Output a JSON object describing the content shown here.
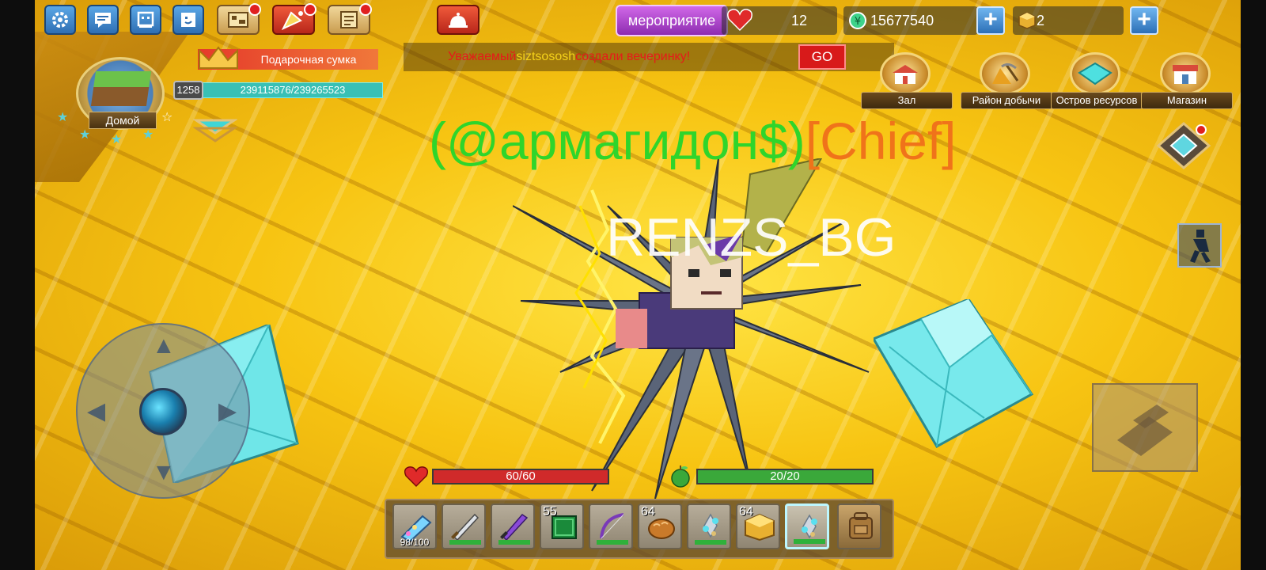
{
  "top_bar": {
    "event_label": "мероприятие",
    "hearts": "12",
    "money": "15677540",
    "gold_blocks": "2"
  },
  "announcement": {
    "prefix": "Уважаемый ",
    "player": "siztsososh",
    "suffix": " создали вечеринку!",
    "go_label": "GO"
  },
  "player_panel": {
    "gift_bag_label": "Подарочная сумка",
    "level": "1258",
    "exp_text": "239115876/239265523",
    "exp_fraction": 0.9994,
    "home_label": "Домой"
  },
  "nav": {
    "hall": "Зал",
    "mining_district": "Район добычи",
    "resource_island": "Остров ресурсов",
    "shop": "Магазин"
  },
  "nametags": {
    "guild_name": "(@армагидон$)",
    "guild_rank": "[Chief]",
    "player_name": "RENZS_BG"
  },
  "stats": {
    "health_text": "60/60",
    "health_fraction": 1.0,
    "hunger_text": "20/20",
    "hunger_fraction": 1.0
  },
  "hotbar": {
    "slots": [
      {
        "item": "drill-gun",
        "count": "",
        "durability": "98/100"
      },
      {
        "item": "sword",
        "count": "",
        "durability": ""
      },
      {
        "item": "purple-sword",
        "count": "",
        "durability": ""
      },
      {
        "item": "emerald-block",
        "count": "55",
        "durability": ""
      },
      {
        "item": "bow",
        "count": "",
        "durability": ""
      },
      {
        "item": "bread",
        "count": "64",
        "durability": ""
      },
      {
        "item": "diamond-ore",
        "count": "",
        "durability": ""
      },
      {
        "item": "gold-block",
        "count": "64",
        "durability": ""
      },
      {
        "item": "diamond-ore",
        "count": "",
        "durability": ""
      },
      {
        "item": "backpack",
        "count": "",
        "durability": ""
      }
    ]
  },
  "colors": {
    "guild_name": "#2fd52b",
    "guild_rank": "#f0731a",
    "announce_text": "#e61a1a",
    "announce_player": "#f5d21a",
    "health": "#d02a2a",
    "hunger": "#3aa83a"
  }
}
